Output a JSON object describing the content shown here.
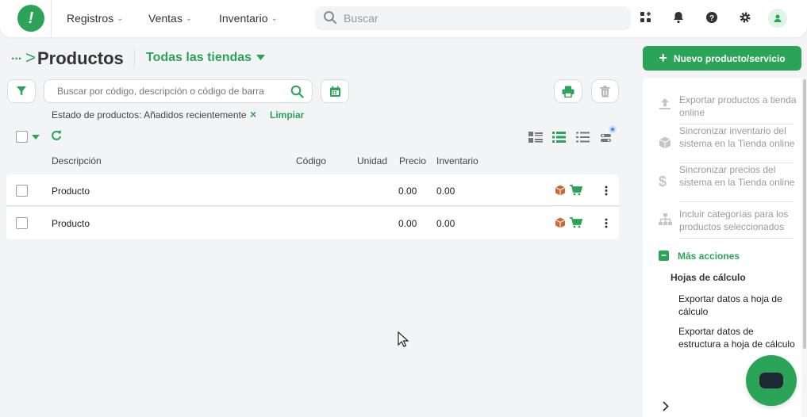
{
  "topbar": {
    "logo_glyph": "!",
    "nav": [
      {
        "label": "Registros"
      },
      {
        "label": "Ventas"
      },
      {
        "label": "Inventario"
      }
    ],
    "search_placeholder": "Buscar",
    "icons": [
      "apps-icon",
      "bell-icon",
      "help-icon",
      "gear-icon",
      "user-icon"
    ]
  },
  "header": {
    "breadcrumb_ellipsis": "...",
    "breadcrumb_arrow": ">",
    "title": "Productos",
    "store_selector": "Todas las tiendas"
  },
  "toolbar": {
    "search_placeholder": "Buscar por código, descripción o código de barra"
  },
  "filter": {
    "text": "Estado de productos: Añadidos recientemente",
    "remove": "×",
    "clear_label": "Limpiar"
  },
  "table": {
    "columns": [
      "Descripción",
      "Código",
      "Unidad",
      "Precio",
      "Inventario"
    ],
    "rows": [
      {
        "description": "Producto",
        "code": "",
        "unit": "",
        "price": "0.00",
        "inventory": "0.00"
      },
      {
        "description": "Producto",
        "code": "",
        "unit": "",
        "price": "0.00",
        "inventory": "0.00"
      }
    ]
  },
  "actions": {
    "new_button": "Nuevo producto/servicio",
    "new_icon": "+",
    "items": [
      {
        "icon": "upload-icon",
        "label": "Exportar productos a tienda online"
      },
      {
        "icon": "box-icon",
        "label": "Sincronizar inventario del sistema en la Tienda online"
      },
      {
        "icon": "dollar-icon",
        "label": "Sincronizar precios del sistema en la Tienda online"
      },
      {
        "icon": "hierarchy-icon",
        "label": "Incluir categorías para los productos seleccionados"
      }
    ],
    "more_label": "Más acciones",
    "more_icon": "−",
    "section_label": "Hojas de cálculo",
    "sub_items": [
      {
        "label": "Exportar datos a hoja de cálculo"
      },
      {
        "label": "Exportar datos de estructura a hoja de cálculo"
      }
    ]
  },
  "colors": {
    "accent": "#2ba457",
    "background": "#f3f4f6",
    "chat_bubble": "#1e2a33"
  }
}
